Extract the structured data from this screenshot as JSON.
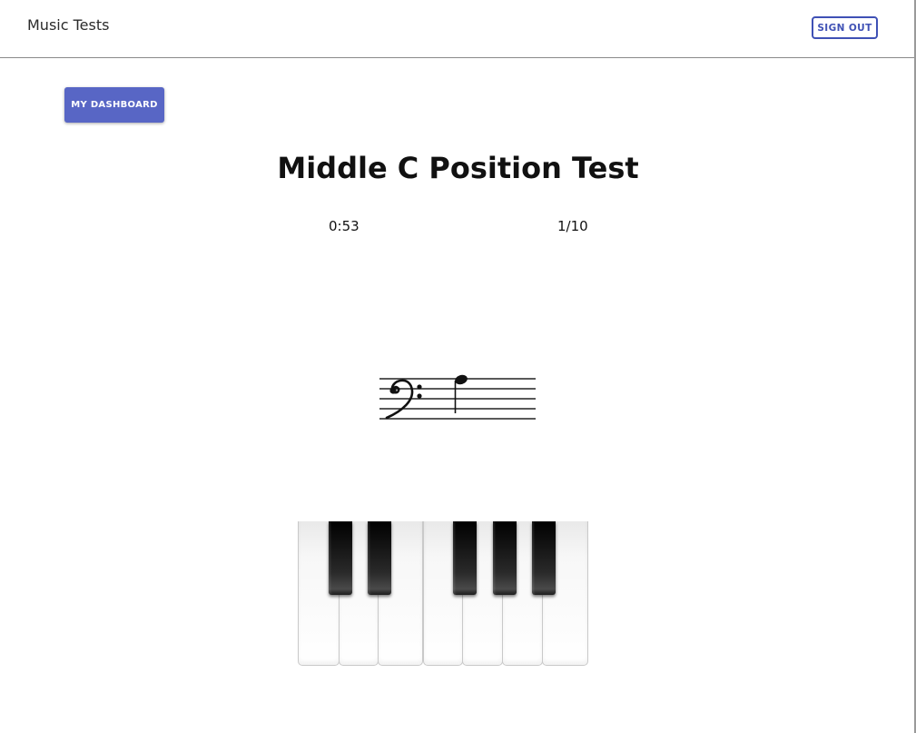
{
  "header": {
    "brand": "Music Tests",
    "sign_out_label": "SIGN OUT"
  },
  "nav": {
    "dashboard_label": "MY DASHBOARD"
  },
  "main": {
    "title": "Middle C Position Test",
    "timer": "0:53",
    "progress": "1/10",
    "staff": {
      "clef": "bass-clef-icon",
      "note": "quarter-note"
    }
  },
  "piano": {
    "white_keys": 7,
    "black_keys": 5
  },
  "colors": {
    "primary": "#3f51b5",
    "primary_button": "#5866c5",
    "divider": "#8a8a8a"
  }
}
